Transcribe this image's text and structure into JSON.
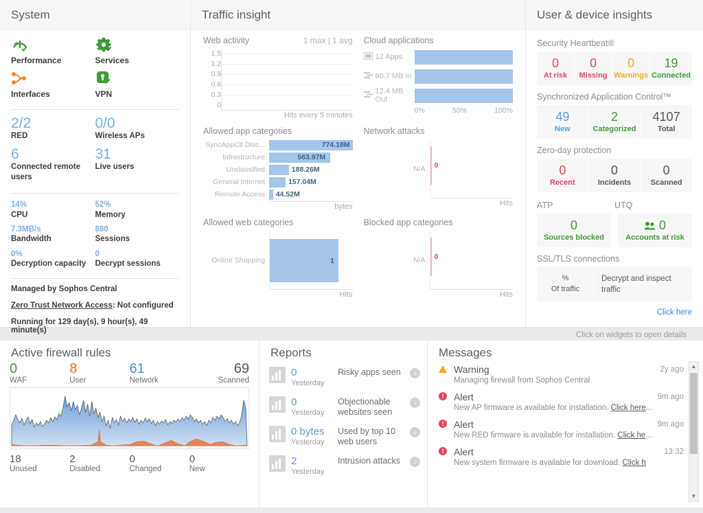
{
  "system": {
    "title": "System",
    "icons": [
      {
        "name": "performance",
        "label": "Performance",
        "icon": "performance-icon",
        "color": "#3f9c35"
      },
      {
        "name": "services",
        "label": "Services",
        "icon": "gear-icon",
        "color": "#3f9c35"
      },
      {
        "name": "interfaces",
        "label": "Interfaces",
        "icon": "interfaces-icon",
        "color": "#ef8c1f"
      },
      {
        "name": "vpn",
        "label": "VPN",
        "icon": "lock-icon",
        "color": "#3f9c35"
      }
    ],
    "big_stats": [
      {
        "value": "2/2",
        "label": "RED"
      },
      {
        "value": "0/0",
        "label": "Wireless APs"
      },
      {
        "value": "6",
        "label": "Connected remote users"
      },
      {
        "value": "31",
        "label": "Live users"
      }
    ],
    "small_stats": [
      {
        "value": "14%",
        "label": "CPU"
      },
      {
        "value": "52%",
        "label": "Memory"
      },
      {
        "value": "7.3MB/s",
        "label": "Bandwidth"
      },
      {
        "value": "880",
        "label": "Sessions"
      },
      {
        "value": "0%",
        "label": "Decryption capacity"
      },
      {
        "value": "0",
        "label": "Decrypt sessions"
      }
    ],
    "managed_by": "Managed by Sophos Central",
    "ztna_link": "Zero Trust Network Access",
    "ztna_status": ": Not configured",
    "uptime": "Running for 129 day(s), 9 hour(s), 49 minute(s)"
  },
  "traffic": {
    "title": "Traffic insight",
    "web_activity": {
      "title": "Web activity",
      "summary": "1 max | 1 avg",
      "footer": "Hits every 5 minutes"
    },
    "cloud_applications": {
      "title": "Cloud applications",
      "rows": [
        {
          "icon": "apps-icon",
          "label": "12 Apps",
          "pct": 100
        },
        {
          "icon": "transfer-icon",
          "label": "60.7 MB In",
          "pct": 100
        },
        {
          "icon": "transfer-icon",
          "label": "12.4 MB Out",
          "pct": 100
        }
      ],
      "axis": [
        "0%",
        "50%",
        "100%"
      ]
    },
    "allowed_app_categories": {
      "title": "Allowed app categories",
      "footer": "bytes",
      "rows": [
        {
          "label": "SyncAppCtl Disc...",
          "value": "774.18M",
          "pct": 100
        },
        {
          "label": "Infrastructure",
          "value": "563.97M",
          "pct": 73
        },
        {
          "label": "Unclassified",
          "value": "188.26M",
          "pct": 24
        },
        {
          "label": "General Internet",
          "value": "157.04M",
          "pct": 20
        },
        {
          "label": "Remote Access",
          "value": "44.52M",
          "pct": 6
        }
      ]
    },
    "network_attacks": {
      "title": "Network attacks",
      "label": "N/A",
      "value": "0",
      "footer": "Hits"
    },
    "allowed_web_categories": {
      "title": "Allowed web categories",
      "label": "Online Shopping",
      "value": "1",
      "footer": "Hits"
    },
    "blocked_app_categories": {
      "title": "Blocked app categories",
      "label": "N/A",
      "value": "0",
      "footer": "Hits"
    }
  },
  "user_device": {
    "title": "User & device insights",
    "security_heartbeat": {
      "title": "Security Heartbeat®",
      "kpis": [
        {
          "value": "0",
          "label": "At risk",
          "color": "red"
        },
        {
          "value": "0",
          "label": "Missing",
          "color": "red"
        },
        {
          "value": "0",
          "label": "Warnings",
          "color": "orange"
        },
        {
          "value": "19",
          "label": "Connected",
          "color": "green"
        }
      ]
    },
    "sync_app_control": {
      "title": "Synchronized Application Control™",
      "kpis": [
        {
          "value": "49",
          "label": "New",
          "color": "blue"
        },
        {
          "value": "2",
          "label": "Categorized",
          "color": "green"
        },
        {
          "value": "4107",
          "label": "Total",
          "color": "gray"
        }
      ]
    },
    "zero_day": {
      "title": "Zero-day protection",
      "kpis": [
        {
          "value": "0",
          "label": "Recent",
          "color": "red"
        },
        {
          "value": "0",
          "label": "Incidents",
          "color": "gray"
        },
        {
          "value": "0",
          "label": "Scanned",
          "color": "gray"
        }
      ]
    },
    "atp": {
      "title": "ATP",
      "value": "0",
      "label": "Sources blocked",
      "color": "green"
    },
    "utq": {
      "title": "UTQ",
      "value": "0",
      "label": "Accounts at risk",
      "color": "green",
      "icon": "users-icon"
    },
    "ssl_tls": {
      "title": "SSL/TLS connections",
      "col1_line1": "%",
      "col1_line2": "Of traffic",
      "col2": "Decrypt and inspect traffic",
      "click_here": "Click here"
    }
  },
  "bottom": {
    "hint": "Click on widgets to open details",
    "firewall": {
      "title": "Active firewall rules",
      "kpis": [
        {
          "value": "0",
          "label": "WAF",
          "color": "g"
        },
        {
          "value": "8",
          "label": "User",
          "color": "o"
        },
        {
          "value": "61",
          "label": "Network",
          "color": "b"
        },
        {
          "value": "69",
          "label": "Scanned",
          "color": "d"
        }
      ],
      "footer": [
        {
          "value": "18",
          "label": "Unused"
        },
        {
          "value": "2",
          "label": "Disabled"
        },
        {
          "value": "0",
          "label": "Changed"
        },
        {
          "value": "0",
          "label": "New"
        }
      ]
    },
    "reports": {
      "title": "Reports",
      "rows": [
        {
          "value": "0",
          "period": "Yesterday",
          "text": "Risky apps seen"
        },
        {
          "value": "0",
          "period": "Yesterday",
          "text": "Objectionable websites seen"
        },
        {
          "value": "0 bytes",
          "period": "Yesterday",
          "text": "Used by top 10 web users"
        },
        {
          "value": "2",
          "period": "Yesterday",
          "text": "Intrusion attacks"
        }
      ]
    },
    "messages": {
      "title": "Messages",
      "items": [
        {
          "type": "warning",
          "title": "Warning",
          "time": "2y ago",
          "body": "Managing firewall from Sophos Central",
          "link": ""
        },
        {
          "type": "alert",
          "title": "Alert",
          "time": "9m ago",
          "body": "New AP firmware is available for installation. ",
          "link": "Click here",
          "tail": "..."
        },
        {
          "type": "alert",
          "title": "Alert",
          "time": "9m ago",
          "body": "New RED firmware is available for installation. ",
          "link": "Click he",
          "tail": "..."
        },
        {
          "type": "alert",
          "title": "Alert",
          "time": "13:32",
          "body": "New system firmware is available for download. ",
          "link": "Click h",
          "tail": ""
        }
      ]
    }
  },
  "chart_data": [
    {
      "type": "line",
      "title": "Web activity",
      "xlabel": "Hits every 5 minutes",
      "ylabel": "",
      "yticks": [
        "1.5",
        "1.2",
        "0.9",
        "0.6",
        "0.3",
        "0"
      ],
      "ylim": [
        0,
        1.5
      ],
      "series": [
        {
          "name": "Hits",
          "values": []
        }
      ],
      "annotation": "1 max | 1 avg",
      "grid": true
    },
    {
      "type": "bar",
      "title": "Cloud applications",
      "orientation": "horizontal",
      "categories": [
        "12 Apps",
        "60.7 MB In",
        "12.4 MB Out"
      ],
      "values": [
        100,
        100,
        100
      ],
      "xticks": [
        "0%",
        "50%",
        "100%"
      ],
      "xlim": [
        0,
        110
      ]
    },
    {
      "type": "bar",
      "title": "Allowed app categories",
      "orientation": "horizontal",
      "categories": [
        "SyncAppCtl Disc...",
        "Infrastructure",
        "Unclassified",
        "General Internet",
        "Remote Access"
      ],
      "values": [
        774.18,
        563.97,
        188.26,
        157.04,
        44.52
      ],
      "value_labels": [
        "774.18M",
        "563.97M",
        "188.26M",
        "157.04M",
        "44.52M"
      ],
      "xlabel": "bytes",
      "xlim": [
        0,
        774.18
      ]
    },
    {
      "type": "bar",
      "title": "Network attacks",
      "orientation": "horizontal",
      "categories": [
        "N/A"
      ],
      "values": [
        0
      ],
      "value_labels": [
        "0"
      ],
      "xlabel": "Hits"
    },
    {
      "type": "bar",
      "title": "Allowed web categories",
      "orientation": "horizontal",
      "categories": [
        "Online Shopping"
      ],
      "values": [
        1
      ],
      "value_labels": [
        "1"
      ],
      "xlabel": "Hits",
      "xlim": [
        0,
        1
      ]
    },
    {
      "type": "bar",
      "title": "Blocked app categories",
      "orientation": "horizontal",
      "categories": [
        "N/A"
      ],
      "values": [
        0
      ],
      "value_labels": [
        "0"
      ],
      "xlabel": "Hits"
    },
    {
      "type": "area",
      "title": "Active firewall rules traffic",
      "series": [
        {
          "name": "blue",
          "color": "#7fa9de"
        },
        {
          "name": "orange",
          "color": "#e8825a"
        }
      ],
      "xlabel": "",
      "ylabel": ""
    }
  ]
}
